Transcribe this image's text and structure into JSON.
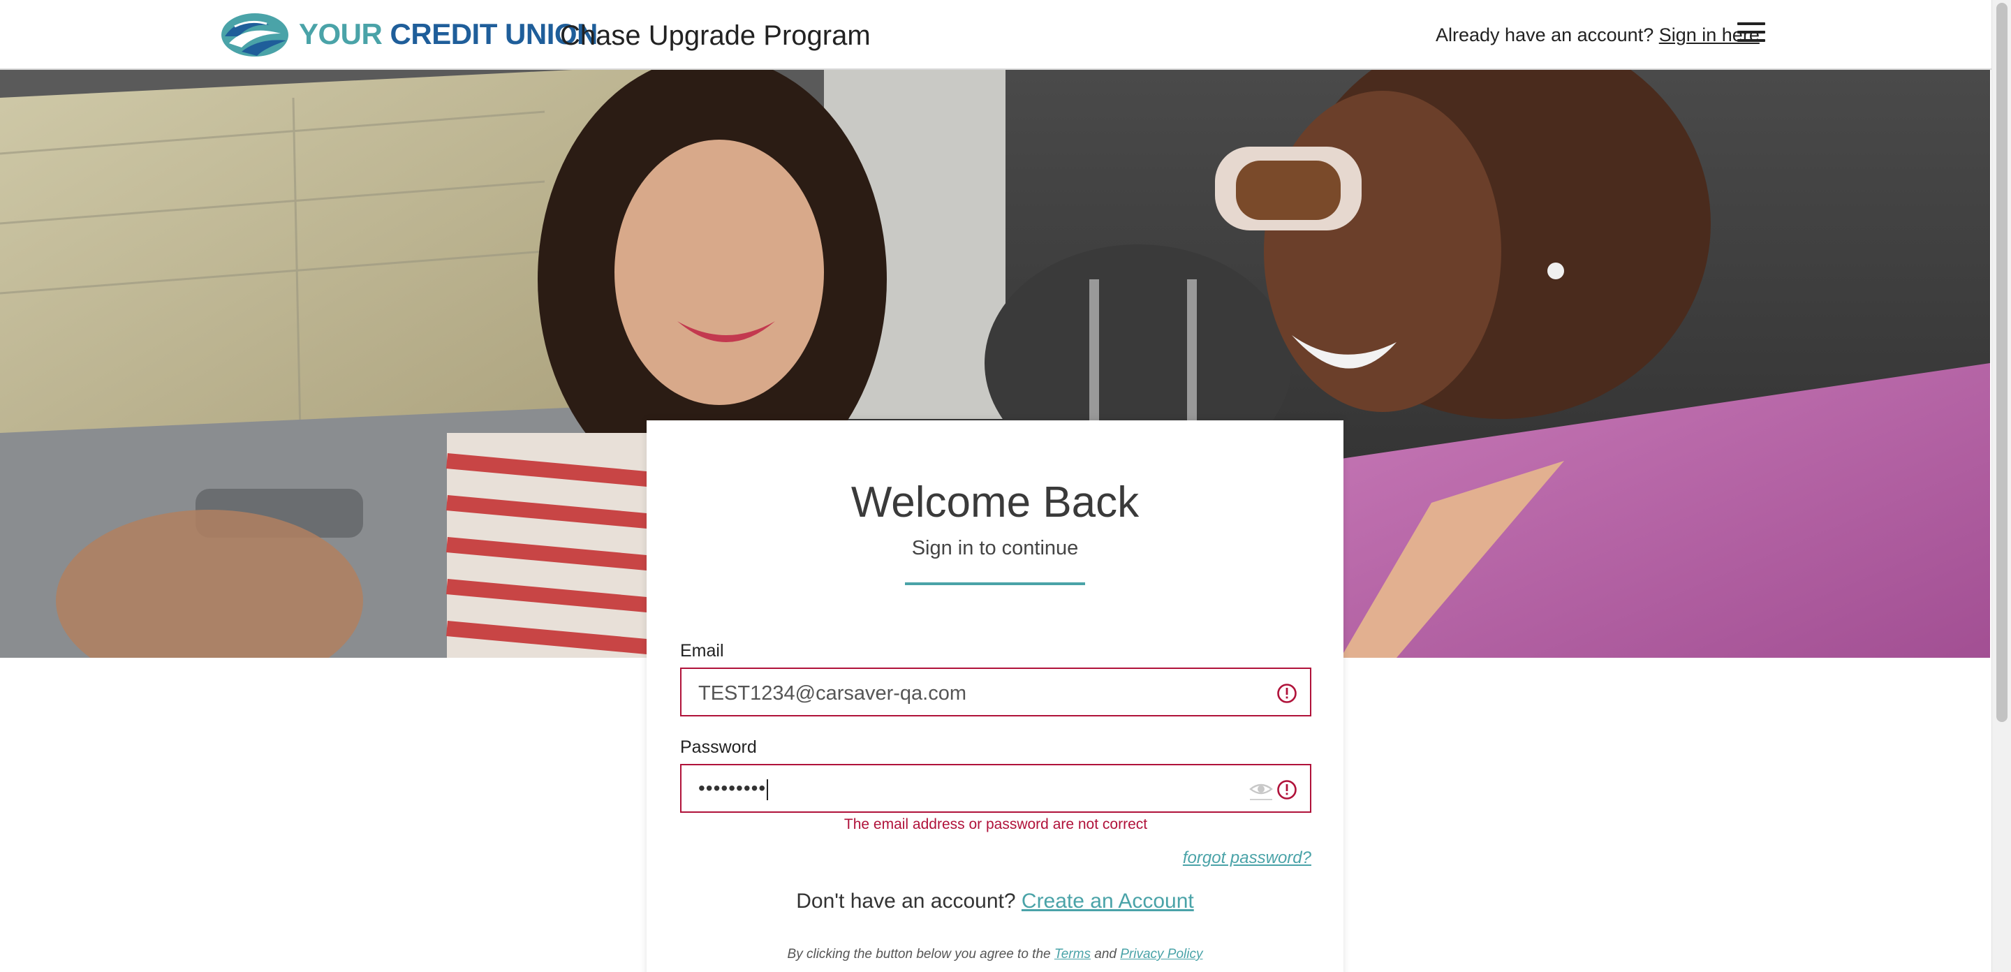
{
  "header": {
    "brand_prefix": "YOUR",
    "brand_name": "CREDIT UNION",
    "program_title": "Chase Upgrade Program",
    "account_prompt": "Already have an account?",
    "sign_in_link": "Sign in here"
  },
  "login": {
    "title": "Welcome Back",
    "subtitle": "Sign in to continue",
    "email_label": "Email",
    "email_value": "TEST1234@carsaver-qa.com",
    "password_label": "Password",
    "password_value": "•••••••••",
    "error_message": "The email address or password are not correct",
    "forgot_link": "forgot password?",
    "no_account_text": "Don't have an account?",
    "create_account_link": "Create an Account",
    "terms_prefix": "By clicking the button below you agree to the",
    "terms_link": "Terms",
    "terms_and": "and",
    "privacy_link": "Privacy Policy"
  },
  "colors": {
    "brand_teal": "#4aa3a8",
    "brand_blue": "#1f5e9a",
    "error_red": "#b0123a"
  },
  "icons": [
    "logo-icon",
    "hamburger-menu-icon",
    "error-icon",
    "show-password-eye-icon"
  ]
}
